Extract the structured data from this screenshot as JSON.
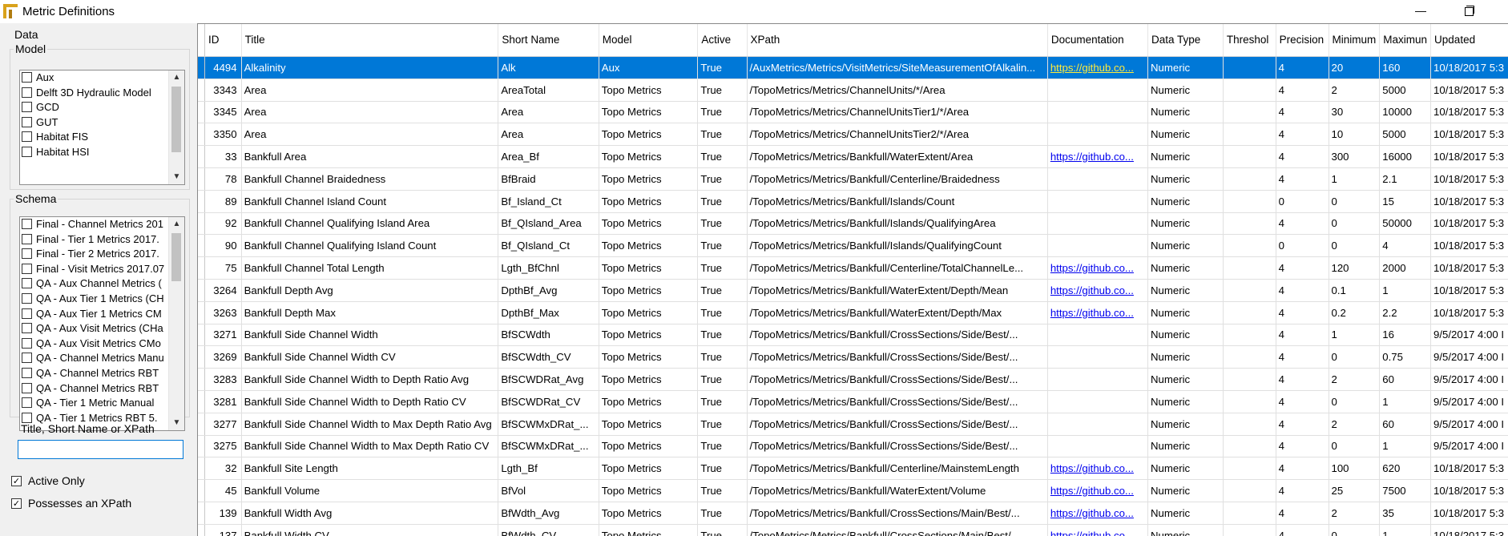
{
  "window": {
    "title": "Metric Definitions"
  },
  "left": {
    "data_label": "Data",
    "model_label": "Model",
    "models": [
      "Aux",
      "Delft 3D Hydraulic Model",
      "GCD",
      "GUT",
      "Habitat FIS",
      "Habitat HSI"
    ],
    "schema_label": "Schema",
    "schemas": [
      "Final - Channel Metrics 201",
      "Final - Tier 1 Metrics 2017.",
      "Final - Tier 2 Metrics 2017.",
      "Final - Visit Metrics 2017.07",
      "QA - Aux Channel Metrics (",
      "QA - Aux Tier 1 Metrics (CH",
      "QA - Aux Tier 1 Metrics CM",
      "QA - Aux Visit Metrics (CHa",
      "QA - Aux Visit Metrics CMo",
      "QA - Channel Metrics Manu",
      "QA - Channel Metrics RBT",
      "QA - Channel Metrics RBT",
      "QA - Tier 1 Metric Manual",
      "QA - Tier 1 Metrics RBT 5."
    ],
    "search_label": "Title, Short Name or XPath",
    "search_value": "",
    "active_only_label": "Active Only",
    "xpath_label": "Possesses an XPath"
  },
  "grid": {
    "columns": [
      "ID",
      "Title",
      "Short Name",
      "Model",
      "Active",
      "XPath",
      "Documentation",
      "Data Type",
      "Threshol",
      "Precision",
      "Minimum",
      "Maximun",
      "Updated"
    ],
    "rows": [
      [
        "4494",
        "Alkalinity",
        "Alk",
        "Aux",
        "True",
        "/AuxMetrics/Metrics/VisitMetrics/SiteMeasurementOfAlkalin...",
        "https://github.co...",
        "Numeric",
        "",
        "4",
        "20",
        "160",
        "10/18/2017 5:3"
      ],
      [
        "3343",
        "Area",
        "AreaTotal",
        "Topo Metrics",
        "True",
        "/TopoMetrics/Metrics/ChannelUnits/*/Area",
        "",
        "Numeric",
        "",
        "4",
        "2",
        "5000",
        "10/18/2017 5:3"
      ],
      [
        "3345",
        "Area",
        "Area",
        "Topo Metrics",
        "True",
        "/TopoMetrics/Metrics/ChannelUnitsTier1/*/Area",
        "",
        "Numeric",
        "",
        "4",
        "30",
        "10000",
        "10/18/2017 5:3"
      ],
      [
        "3350",
        "Area",
        "Area",
        "Topo Metrics",
        "True",
        "/TopoMetrics/Metrics/ChannelUnitsTier2/*/Area",
        "",
        "Numeric",
        "",
        "4",
        "10",
        "5000",
        "10/18/2017 5:3"
      ],
      [
        "33",
        "Bankfull Area",
        "Area_Bf",
        "Topo Metrics",
        "True",
        "/TopoMetrics/Metrics/Bankfull/WaterExtent/Area",
        "https://github.co...",
        "Numeric",
        "",
        "4",
        "300",
        "16000",
        "10/18/2017 5:3"
      ],
      [
        "78",
        "Bankfull Channel Braidedness",
        "BfBraid",
        "Topo Metrics",
        "True",
        "/TopoMetrics/Metrics/Bankfull/Centerline/Braidedness",
        "",
        "Numeric",
        "",
        "4",
        "1",
        "2.1",
        "10/18/2017 5:3"
      ],
      [
        "89",
        "Bankfull Channel Island Count",
        "Bf_Island_Ct",
        "Topo Metrics",
        "True",
        "/TopoMetrics/Metrics/Bankfull/Islands/Count",
        "",
        "Numeric",
        "",
        "0",
        "0",
        "15",
        "10/18/2017 5:3"
      ],
      [
        "92",
        "Bankfull Channel Qualifying Island Area",
        "Bf_QIsland_Area",
        "Topo Metrics",
        "True",
        "/TopoMetrics/Metrics/Bankfull/Islands/QualifyingArea",
        "",
        "Numeric",
        "",
        "4",
        "0",
        "50000",
        "10/18/2017 5:3"
      ],
      [
        "90",
        "Bankfull Channel Qualifying Island Count",
        "Bf_QIsland_Ct",
        "Topo Metrics",
        "True",
        "/TopoMetrics/Metrics/Bankfull/Islands/QualifyingCount",
        "",
        "Numeric",
        "",
        "0",
        "0",
        "4",
        "10/18/2017 5:3"
      ],
      [
        "75",
        "Bankfull Channel Total Length",
        "Lgth_BfChnl",
        "Topo Metrics",
        "True",
        "/TopoMetrics/Metrics/Bankfull/Centerline/TotalChannelLe...",
        "https://github.co...",
        "Numeric",
        "",
        "4",
        "120",
        "2000",
        "10/18/2017 5:3"
      ],
      [
        "3264",
        "Bankfull Depth Avg",
        "DpthBf_Avg",
        "Topo Metrics",
        "True",
        "/TopoMetrics/Metrics/Bankfull/WaterExtent/Depth/Mean",
        "https://github.co...",
        "Numeric",
        "",
        "4",
        "0.1",
        "1",
        "10/18/2017 5:3"
      ],
      [
        "3263",
        "Bankfull Depth Max",
        "DpthBf_Max",
        "Topo Metrics",
        "True",
        "/TopoMetrics/Metrics/Bankfull/WaterExtent/Depth/Max",
        "https://github.co...",
        "Numeric",
        "",
        "4",
        "0.2",
        "2.2",
        "10/18/2017 5:3"
      ],
      [
        "3271",
        "Bankfull Side Channel Width",
        "BfSCWdth",
        "Topo Metrics",
        "True",
        "/TopoMetrics/Metrics/Bankfull/CrossSections/Side/Best/...",
        "",
        "Numeric",
        "",
        "4",
        "1",
        "16",
        "9/5/2017 4:00 I"
      ],
      [
        "3269",
        "Bankfull Side Channel Width CV",
        "BfSCWdth_CV",
        "Topo Metrics",
        "True",
        "/TopoMetrics/Metrics/Bankfull/CrossSections/Side/Best/...",
        "",
        "Numeric",
        "",
        "4",
        "0",
        "0.75",
        "9/5/2017 4:00 I"
      ],
      [
        "3283",
        "Bankfull Side Channel Width to Depth Ratio Avg",
        "BfSCWDRat_Avg",
        "Topo Metrics",
        "True",
        "/TopoMetrics/Metrics/Bankfull/CrossSections/Side/Best/...",
        "",
        "Numeric",
        "",
        "4",
        "2",
        "60",
        "9/5/2017 4:00 I"
      ],
      [
        "3281",
        "Bankfull Side Channel Width to Depth Ratio CV",
        "BfSCWDRat_CV",
        "Topo Metrics",
        "True",
        "/TopoMetrics/Metrics/Bankfull/CrossSections/Side/Best/...",
        "",
        "Numeric",
        "",
        "4",
        "0",
        "1",
        "9/5/2017 4:00 I"
      ],
      [
        "3277",
        "Bankfull Side Channel Width to Max Depth Ratio Avg",
        "BfSCWMxDRat_...",
        "Topo Metrics",
        "True",
        "/TopoMetrics/Metrics/Bankfull/CrossSections/Side/Best/...",
        "",
        "Numeric",
        "",
        "4",
        "2",
        "60",
        "9/5/2017 4:00 I"
      ],
      [
        "3275",
        "Bankfull Side Channel Width to Max Depth Ratio CV",
        "BfSCWMxDRat_...",
        "Topo Metrics",
        "True",
        "/TopoMetrics/Metrics/Bankfull/CrossSections/Side/Best/...",
        "",
        "Numeric",
        "",
        "4",
        "0",
        "1",
        "9/5/2017 4:00 I"
      ],
      [
        "32",
        "Bankfull Site Length",
        "Lgth_Bf",
        "Topo Metrics",
        "True",
        "/TopoMetrics/Metrics/Bankfull/Centerline/MainstemLength",
        "https://github.co...",
        "Numeric",
        "",
        "4",
        "100",
        "620",
        "10/18/2017 5:3"
      ],
      [
        "45",
        "Bankfull Volume",
        "BfVol",
        "Topo Metrics",
        "True",
        "/TopoMetrics/Metrics/Bankfull/WaterExtent/Volume",
        "https://github.co...",
        "Numeric",
        "",
        "4",
        "25",
        "7500",
        "10/18/2017 5:3"
      ],
      [
        "139",
        "Bankfull Width Avg",
        "BfWdth_Avg",
        "Topo Metrics",
        "True",
        "/TopoMetrics/Metrics/Bankfull/CrossSections/Main/Best/...",
        "https://github.co...",
        "Numeric",
        "",
        "4",
        "2",
        "35",
        "10/18/2017 5:3"
      ],
      [
        "137",
        "Bankfull Width CV",
        "BfWdth_CV",
        "Topo Metrics",
        "True",
        "/TopoMetrics/Metrics/Bankfull/CrossSections/Main/Best/...",
        "https://github.co...",
        "Numeric",
        "",
        "4",
        "0",
        "1",
        "10/18/2017 5:3"
      ]
    ]
  }
}
